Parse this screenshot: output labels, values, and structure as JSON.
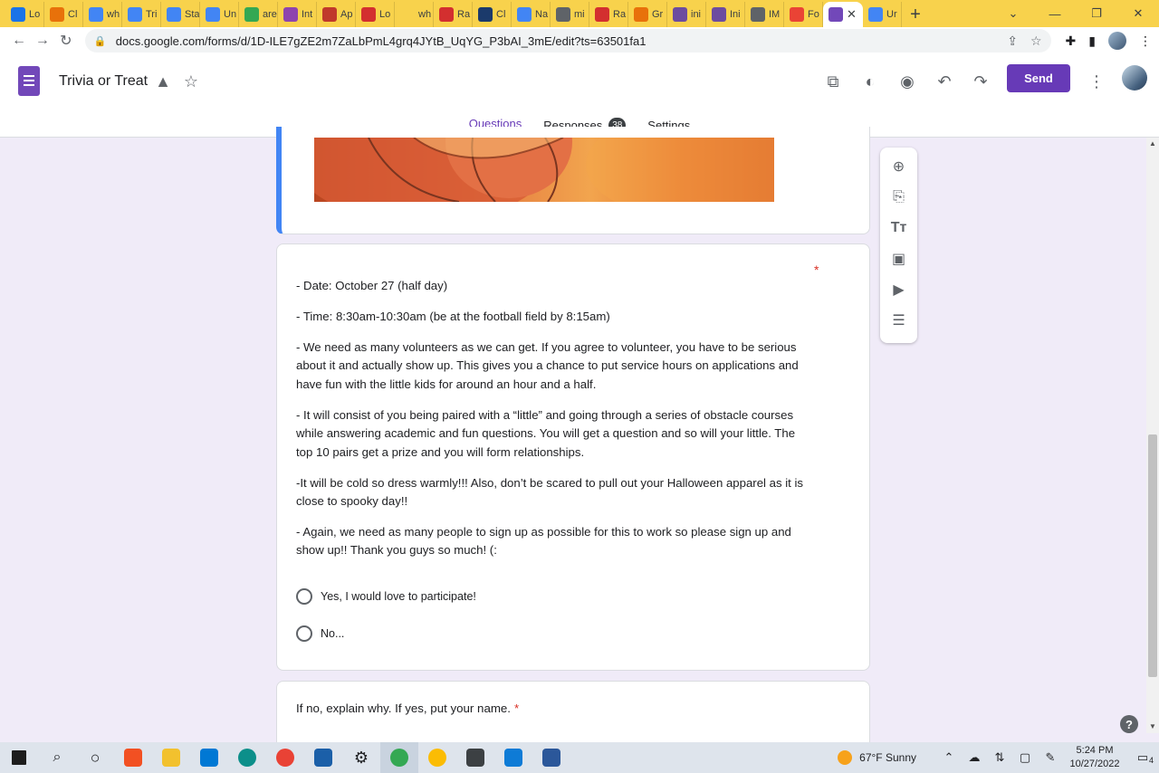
{
  "browser": {
    "tabs": [
      {
        "label": "Lo",
        "color": "#1a73e8"
      },
      {
        "label": "Cl",
        "color": "#e8710a"
      },
      {
        "label": "wh",
        "color": "#4285f4"
      },
      {
        "label": "Tri",
        "color": "#4285f4"
      },
      {
        "label": "Sta",
        "color": "#4285f4"
      },
      {
        "label": "Un",
        "color": "#4285f4"
      },
      {
        "label": "are",
        "color": "#34a853"
      },
      {
        "label": "Int",
        "color": "#8e44ad"
      },
      {
        "label": "Ap",
        "color": "#c0392b"
      },
      {
        "label": "Lo",
        "color": "#d32f2f"
      },
      {
        "label": "wh cc",
        "color": "#f8d24c"
      },
      {
        "label": "Ra",
        "color": "#d32f2f"
      },
      {
        "label": "Cl",
        "color": "#1b3a6b"
      },
      {
        "label": "Na",
        "color": "#4285f4"
      },
      {
        "label": "mi",
        "color": "#5f6368"
      },
      {
        "label": "Ra",
        "color": "#d32f2f"
      },
      {
        "label": "Gr",
        "color": "#e8710a"
      },
      {
        "label": "ini",
        "color": "#6d4c9f"
      },
      {
        "label": "Ini",
        "color": "#6d4c9f"
      },
      {
        "label": "IM",
        "color": "#5f6368"
      },
      {
        "label": "Fo",
        "color": "#ea4335"
      }
    ],
    "active_tab_close": "✕",
    "last_tab_label": "Ur",
    "url": "docs.google.com/forms/d/1D-ILE7gZE2m7ZaLbPmL4grq4JYtB_UqYG_P3bAI_3mE/edit?ts=63501fa1"
  },
  "header": {
    "title": "Trivia or Treat",
    "send_label": "Send",
    "tabs": [
      {
        "label": "Questions"
      },
      {
        "label": "Responses",
        "badge": "38"
      },
      {
        "label": "Settings"
      }
    ]
  },
  "question": {
    "required_mark": "*",
    "description": [
      "- Date: October 27 (half day)",
      "- Time: 8:30am-10:30am (be at the football field by 8:15am)",
      "- We need as many volunteers as we can get. If you agree to volunteer, you have to be serious about it and actually show up. This gives you a chance to put service hours on applications and have fun with the little kids for around an hour and a half.",
      "- It will consist of you being paired with a “little” and going through a series of obstacle courses while answering academic and fun questions. You will get a question and so will your little. The top 10 pairs get a prize and you will form relationships.",
      "-It will be cold so dress warmly!!! Also, don’t be scared to pull out your Halloween apparel as it is close to spooky day!!",
      "- Again, we need as many people to sign up as possible for this to work so please sign up and show up!! Thank you guys so much! (:"
    ],
    "options": [
      "Yes, I would love to participate!",
      "No..."
    ]
  },
  "question2": {
    "title": "If no, explain why. If yes, put your name.",
    "required_mark": "*"
  },
  "taskbar": {
    "weather": "67°F  Sunny",
    "time": "5:24 PM",
    "date": "10/27/2022",
    "notifications": "4"
  }
}
